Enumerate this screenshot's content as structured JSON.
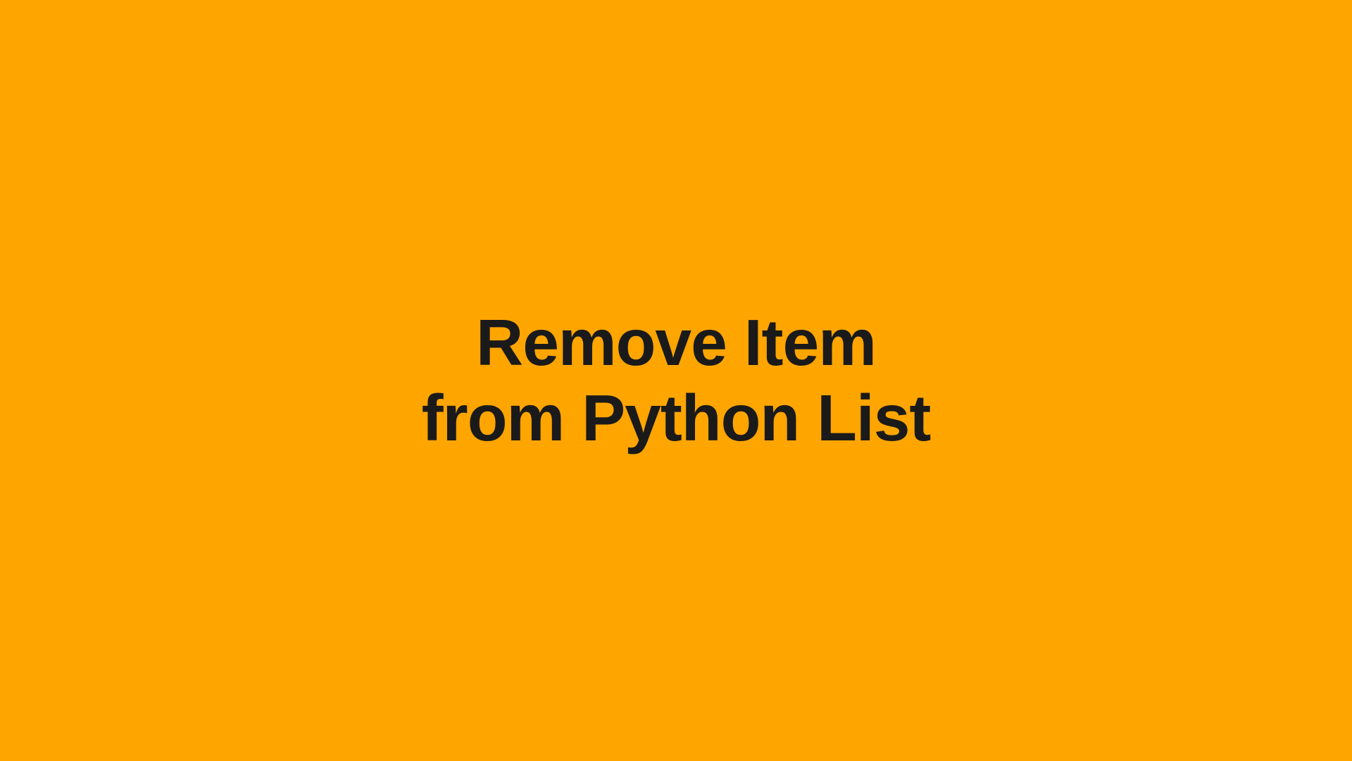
{
  "title": {
    "line1": "Remove Item",
    "line2": "from Python List"
  }
}
